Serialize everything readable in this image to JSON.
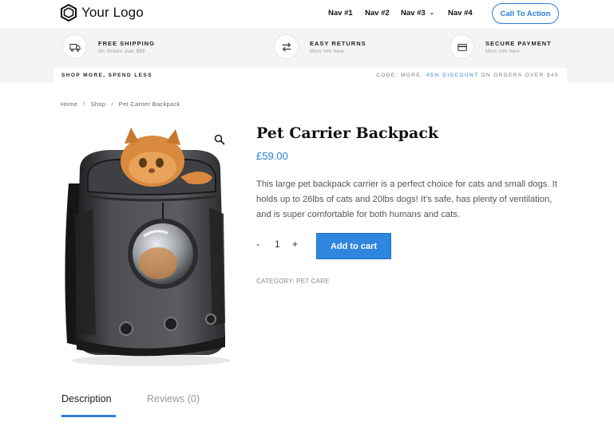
{
  "header": {
    "logo_text": "Your Logo",
    "nav": [
      {
        "label": "Nav #1"
      },
      {
        "label": "Nav #2"
      },
      {
        "label": "Nav #3",
        "has_dropdown": true
      },
      {
        "label": "Nav #4"
      }
    ],
    "cta_label": "Call To Action"
  },
  "features": [
    {
      "title": "FREE SHIPPING",
      "subtitle": "On Orders over $99",
      "icon": "truck-icon"
    },
    {
      "title": "EASY RETURNS",
      "subtitle": "More info here",
      "icon": "exchange-icon"
    },
    {
      "title": "SECURE PAYMENT",
      "subtitle": "More info here",
      "icon": "credit-card-icon"
    }
  ],
  "promo": {
    "left": "SHOP MORE, SPEND LESS",
    "right_prefix": "CODE: MORE-",
    "right_highlight": "45% DISCOUNT",
    "right_suffix": "ON ORDERS OVER $45"
  },
  "breadcrumb": [
    "Home",
    "Shop",
    "Pet Carrier Backpack"
  ],
  "product": {
    "title": "Pet Carrier Backpack",
    "price": "£59.00",
    "description": "This large pet backpack carrier is a perfect choice for cats and small dogs. It holds up to 26lbs of cats and 20lbs dogs! It's safe, has plenty of ventilation, and is super comfortable for both humans and cats.",
    "quantity": "1",
    "minus": "-",
    "plus": "+",
    "add_to_cart": "Add to cart",
    "category": "CATEGORY: PET CARE"
  },
  "tabs": [
    {
      "label": "Description",
      "active": true
    },
    {
      "label": "Reviews (0)",
      "active": false
    }
  ],
  "colors": {
    "accent": "#2b7fd8",
    "button": "#2e86de",
    "band": "#f4f4f4"
  }
}
